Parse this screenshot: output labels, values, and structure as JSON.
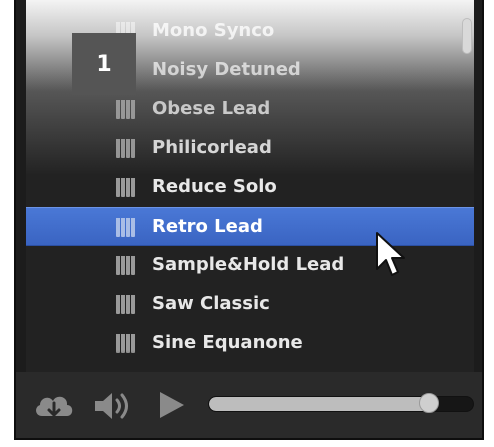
{
  "presets": [
    {
      "name": "Mono Synco",
      "selected": false
    },
    {
      "name": "Noisy Detuned",
      "selected": false
    },
    {
      "name": "Obese Lead",
      "selected": false
    },
    {
      "name": "Philicorlead",
      "selected": false
    },
    {
      "name": "Reduce Solo",
      "selected": false
    },
    {
      "name": "Retro Lead",
      "selected": true
    },
    {
      "name": "Sample&Hold Lead",
      "selected": false
    },
    {
      "name": "Saw Classic",
      "selected": false
    },
    {
      "name": "Sine Equanone",
      "selected": false
    },
    {
      "name": "",
      "selected": false
    }
  ],
  "preset_icon": "piano-keys-icon",
  "step_badge": "1",
  "transport": {
    "icons": [
      "cloud-download-icon",
      "volume-icon",
      "play-icon"
    ],
    "progress_fraction": 0.83
  },
  "colors": {
    "selection": "#3a64c2",
    "list_background": "#222222",
    "transport_background": "#2a2a2a"
  }
}
